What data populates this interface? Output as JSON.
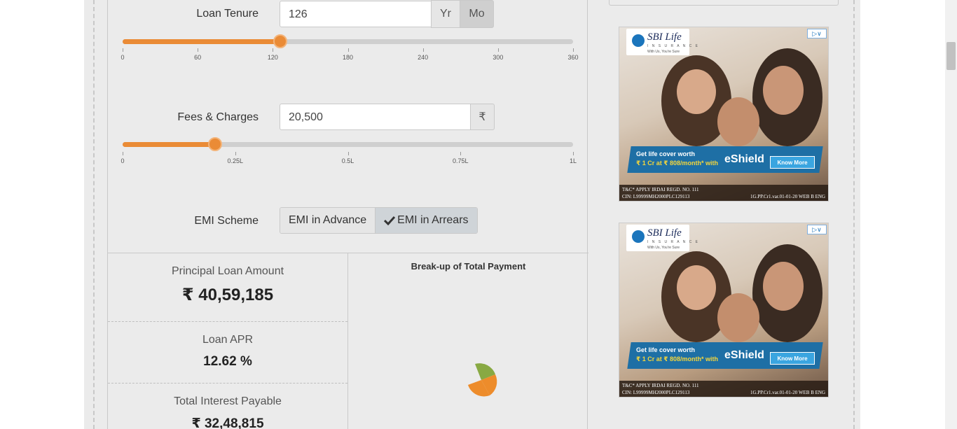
{
  "loan_tenure": {
    "label": "Loan Tenure",
    "value": "126",
    "unit_year": "Yr",
    "unit_month": "Mo",
    "active_unit": "Mo",
    "slider_fraction": 0.35,
    "ticks": [
      "0",
      "60",
      "120",
      "180",
      "240",
      "300",
      "360"
    ]
  },
  "fees": {
    "label": "Fees & Charges",
    "value": "20,500",
    "currency": "₹",
    "slider_fraction": 0.205,
    "ticks": [
      "0",
      "0.25L",
      "0.5L",
      "0.75L",
      "1L"
    ]
  },
  "emi_scheme": {
    "label": "EMI Scheme",
    "option_advance": "EMI in Advance",
    "option_arrears": "EMI in Arrears",
    "selected": "EMI in Arrears"
  },
  "results": {
    "principal_label": "Principal Loan Amount",
    "principal_value": "₹ 40,59,185",
    "apr_label": "Loan APR",
    "apr_value": "12.62 %",
    "interest_label": "Total Interest Payable",
    "interest_value": "₹ 32,48,815"
  },
  "chart": {
    "title": "Break-up of Total Payment",
    "colors": {
      "principal": "#88a943",
      "interest": "#ed8c2b"
    }
  },
  "ads": [
    {
      "brand": "SBI Life",
      "brand_sub": "I N S U R A N C E",
      "tagline": "With Us, You're Sure",
      "line1": "Get life cover worth",
      "line2": "₹ 1 Cr at ₹ 808/month* with",
      "product": "eShield",
      "cta": "Know More",
      "foot1": "T&C* APPLY  IRDAI REGD. NO. 111",
      "foot2": "CIN: L99999MH2000PLC129113",
      "foot3": "1G.PP.Cr1.var.01-01-20 WEB B ENG"
    },
    {
      "brand": "SBI Life",
      "brand_sub": "I N S U R A N C E",
      "tagline": "With Us, You're Sure",
      "line1": "Get life cover worth",
      "line2": "₹ 1 Cr at ₹ 808/month* with",
      "product": "eShield",
      "cta": "Know More",
      "foot1": "T&C* APPLY  IRDAI REGD. NO. 111",
      "foot2": "CIN: L99999MH2000PLC129113",
      "foot3": "1G.PP.Cr1.var.01-01-20 WEB B ENG"
    }
  ],
  "icons": {
    "currency": "rupee-icon",
    "check": "check-icon",
    "adchoices": "adchoices-icon"
  }
}
